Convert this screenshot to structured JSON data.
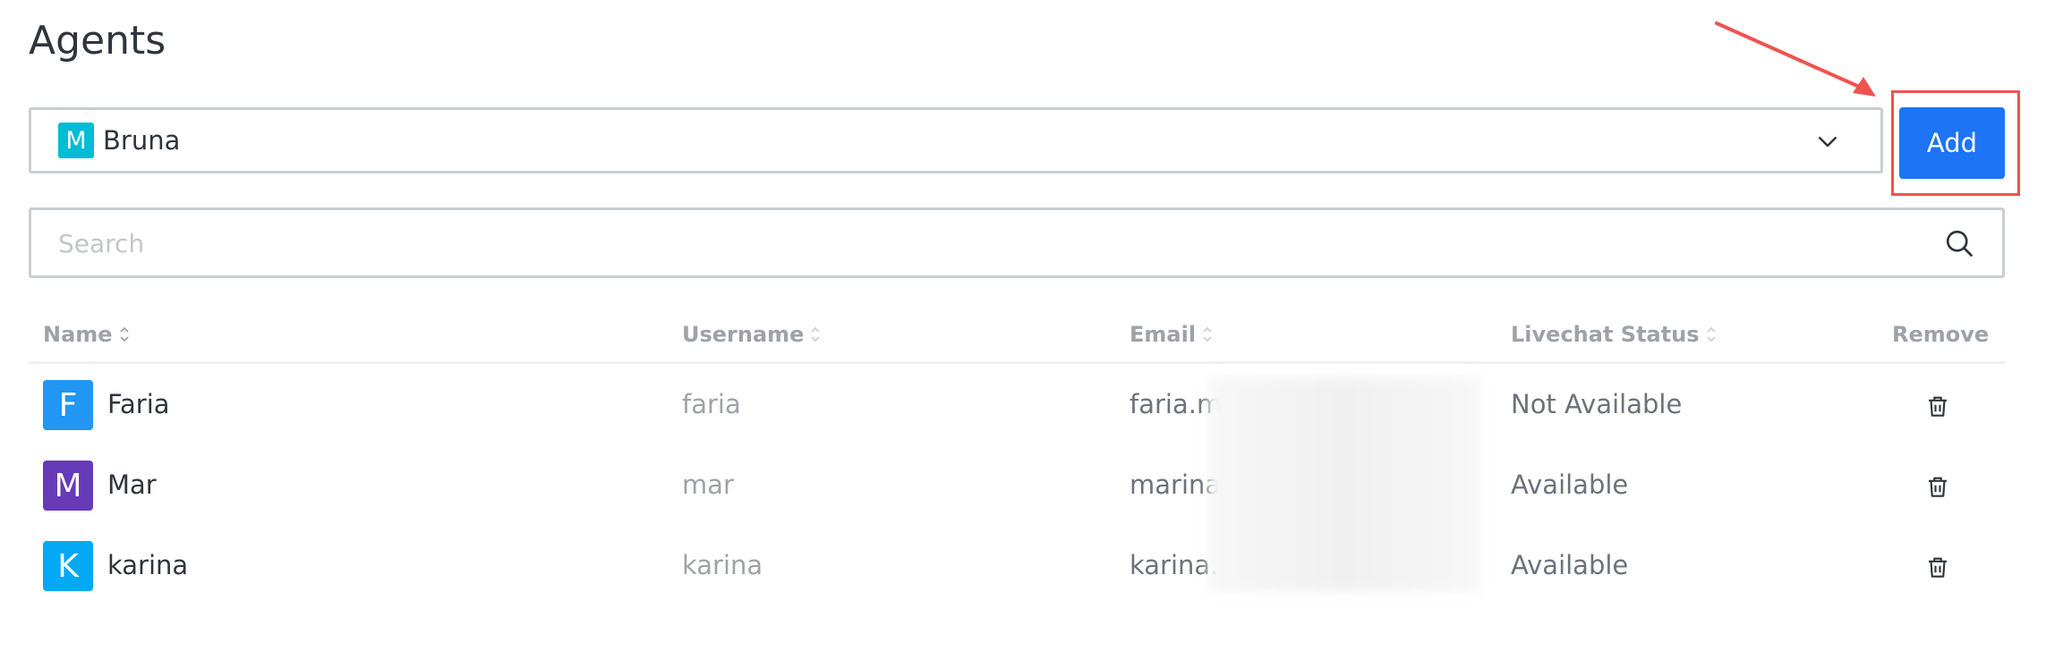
{
  "page": {
    "title": "Agents"
  },
  "agent_select": {
    "avatar_letter": "M",
    "avatar_color": "#00bcd4",
    "value": "Bruna"
  },
  "add_button": {
    "label": "Add",
    "color": "#1d74f5"
  },
  "search": {
    "placeholder": "Search"
  },
  "table": {
    "headers": {
      "name": "Name",
      "username": "Username",
      "email": "Email",
      "status": "Livechat Status",
      "remove": "Remove"
    },
    "rows": [
      {
        "avatar_letter": "F",
        "avatar_color": "#2196f3",
        "name": "Faria",
        "username": "faria",
        "email": "faria.m",
        "status": "Not Available"
      },
      {
        "avatar_letter": "M",
        "avatar_color": "#673ab7",
        "name": "Mar",
        "username": "mar",
        "email": "marina",
        "status": "Available"
      },
      {
        "avatar_letter": "K",
        "avatar_color": "#03a9f4",
        "name": "karina",
        "username": "karina",
        "email": "karina.",
        "status": "Available"
      }
    ]
  },
  "annotation": {
    "highlight_color": "#ef5350"
  }
}
